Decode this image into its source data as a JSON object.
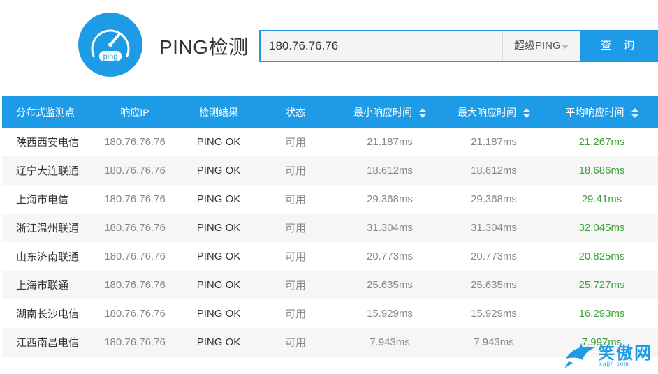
{
  "header": {
    "logo_text": "ping",
    "title": "PING检测"
  },
  "search": {
    "value": "180.76.76.76",
    "mode": "超级PING",
    "button": "查 询"
  },
  "table": {
    "headers": [
      "分布式监测点",
      "响应IP",
      "检测结果",
      "状态",
      "最小响应时间",
      "最大响应时间",
      "平均响应时间"
    ],
    "rows": [
      {
        "node": "陕西西安电信",
        "ip": "180.76.76.76",
        "result": "PING OK",
        "status": "可用",
        "min": "21.187ms",
        "max": "21.187ms",
        "avg": "21.267ms"
      },
      {
        "node": "辽宁大连联通",
        "ip": "180.76.76.76",
        "result": "PING OK",
        "status": "可用",
        "min": "18.612ms",
        "max": "18.612ms",
        "avg": "18.686ms"
      },
      {
        "node": "上海市电信",
        "ip": "180.76.76.76",
        "result": "PING OK",
        "status": "可用",
        "min": "29.368ms",
        "max": "29.368ms",
        "avg": "29.41ms"
      },
      {
        "node": "浙江温州联通",
        "ip": "180.76.76.76",
        "result": "PING OK",
        "status": "可用",
        "min": "31.304ms",
        "max": "31.304ms",
        "avg": "32.045ms"
      },
      {
        "node": "山东济南联通",
        "ip": "180.76.76.76",
        "result": "PING OK",
        "status": "可用",
        "min": "20.773ms",
        "max": "20.773ms",
        "avg": "20.825ms"
      },
      {
        "node": "上海市联通",
        "ip": "180.76.76.76",
        "result": "PING OK",
        "status": "可用",
        "min": "25.635ms",
        "max": "25.635ms",
        "avg": "25.727ms"
      },
      {
        "node": "湖南长沙电信",
        "ip": "180.76.76.76",
        "result": "PING OK",
        "status": "可用",
        "min": "15.929ms",
        "max": "15.929ms",
        "avg": "16.293ms"
      },
      {
        "node": "江西南昌电信",
        "ip": "180.76.76.76",
        "result": "PING OK",
        "status": "可用",
        "min": "7.943ms",
        "max": "7.943ms",
        "avg": "7.997ms"
      }
    ]
  },
  "watermark": {
    "text": "笑傲网",
    "sub": "xajjn.com"
  },
  "colors": {
    "accent": "#1e9be6",
    "avg_text": "#3ca23c"
  }
}
